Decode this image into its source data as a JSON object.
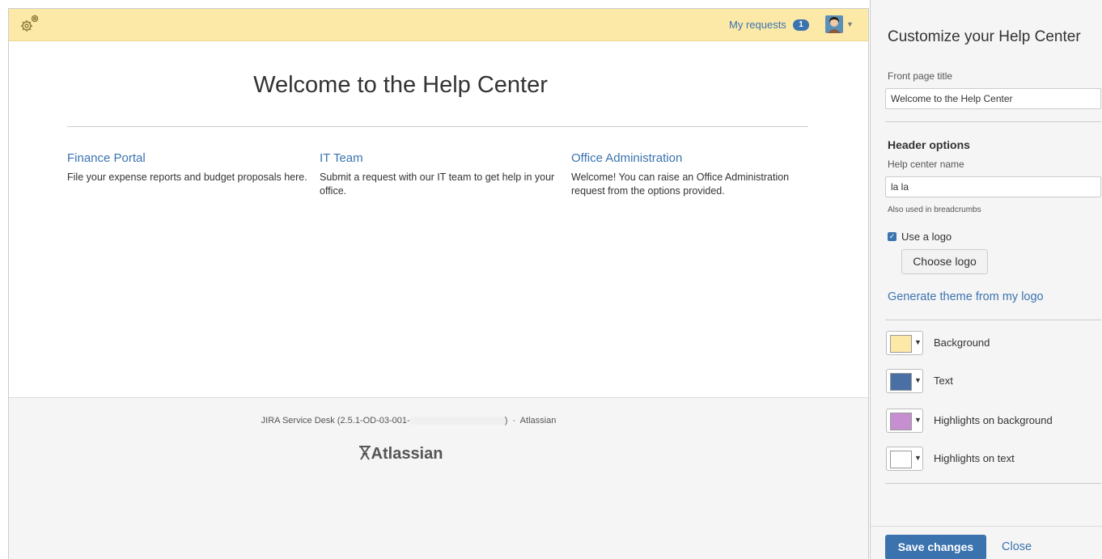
{
  "header": {
    "my_requests_label": "My requests",
    "my_requests_count": "1"
  },
  "main": {
    "title": "Welcome to the Help Center",
    "portals": [
      {
        "title": "Finance Portal",
        "description": "File your expense reports and budget proposals here."
      },
      {
        "title": "IT Team",
        "description": "Submit a request with our IT team to get help in your office."
      },
      {
        "title": "Office Administration",
        "description": "Welcome! You can raise an Office Administration request from the options provided."
      }
    ]
  },
  "footer": {
    "version_prefix": "JIRA Service Desk (2.5.1-OD-03-001-",
    "version_suffix": ")",
    "separator": "·",
    "link": "Atlassian",
    "logo_text": "Atlassian"
  },
  "customize": {
    "title": "Customize your Help Center",
    "front_page_title_label": "Front page title",
    "front_page_title_value": "Welcome to the Help Center",
    "header_options_label": "Header options",
    "help_center_name_label": "Help center name",
    "help_center_name_value": "la la",
    "help_center_name_hint": "Also used in breadcrumbs",
    "use_logo_label": "Use a logo",
    "choose_logo_label": "Choose logo",
    "generate_theme_label": "Generate theme from my logo",
    "colors": [
      {
        "label": "Background",
        "color": "#fce9a8"
      },
      {
        "label": "Text",
        "color": "#4a6fa5"
      },
      {
        "label": "Highlights on background",
        "color": "#c58fd0"
      },
      {
        "label": "Highlights on text",
        "color": "#ffffff"
      }
    ],
    "save_label": "Save changes",
    "close_label": "Close"
  }
}
